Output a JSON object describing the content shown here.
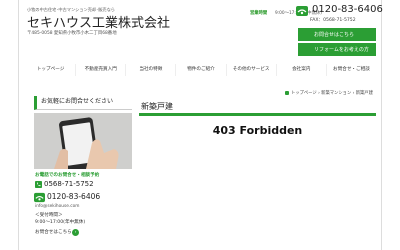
{
  "header": {
    "tagline": "小牧の中古住宅･中古マンション売却･販売なら",
    "company_name": "セキハウス工業株式会社",
    "address": "〒485-0058 愛知県小牧市小木二丁目68番地",
    "hours_label": "営業時間",
    "hours": "9:00～17:00(年中無休)",
    "phone": "0120-83-6406",
    "fax": "FAX：0568-71-5752",
    "contact_button": "お問合せはこちら",
    "reform_button": "リフォームをお考えの方"
  },
  "nav": {
    "items": [
      "トップページ",
      "不動産売買入門",
      "当社の特徴",
      "物件のご紹介",
      "その他のサービス",
      "会社案内",
      "お問合せ・ご相談"
    ]
  },
  "sidebar": {
    "title": "お気軽にお問合せください",
    "lead": "お電話でのお問合せ・相談予約",
    "tel": "0568-71-5752",
    "freedial": "0120-83-6406",
    "email": "info@sekihouse.com",
    "reception_label": "＜受付時間＞",
    "reception_hours": "9:00～17:00(年中無休)",
    "contact_link": "お問合せはこちら",
    "arrow": "›"
  },
  "breadcrumb": {
    "home": "トップページ",
    "sep1": "›",
    "parent": "新築マンション",
    "sep2": "›",
    "current": "新築戸建"
  },
  "main": {
    "title": "新築戸建",
    "message": "403 Forbidden"
  },
  "colors": {
    "accent": "#2b9e34"
  }
}
